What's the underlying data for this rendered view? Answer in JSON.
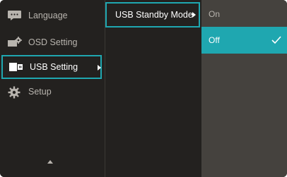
{
  "menu": {
    "items": [
      {
        "label": "Language",
        "icon": "language-icon"
      },
      {
        "label": "OSD Setting",
        "icon": "osd-setting-icon"
      },
      {
        "label": "USB Setting",
        "icon": "usb-setting-icon"
      },
      {
        "label": "Setup",
        "icon": "setup-gear-icon"
      }
    ]
  },
  "submenu": {
    "items": [
      {
        "label": "USB Standby Mode"
      }
    ]
  },
  "options": {
    "items": [
      {
        "label": "On"
      },
      {
        "label": "Off"
      }
    ],
    "selected": "Off"
  },
  "colors": {
    "accent": "#1fa7b0",
    "panel": "#23211f",
    "options_panel": "#45423e",
    "text": "#b8b4ae"
  }
}
